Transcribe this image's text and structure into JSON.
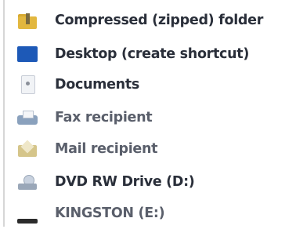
{
  "context_menu": {
    "items": [
      {
        "label": "Compressed (zipped) folder",
        "icon": "zip-folder-icon"
      },
      {
        "label": "Desktop (create shortcut)",
        "icon": "desktop-icon"
      },
      {
        "label": "Documents",
        "icon": "documents-icon"
      },
      {
        "label": "Fax recipient",
        "icon": "fax-icon"
      },
      {
        "label": "Mail recipient",
        "icon": "mail-icon"
      },
      {
        "label": "DVD RW Drive (D:)",
        "icon": "dvd-drive-icon"
      },
      {
        "label": "KINGSTON (E:)",
        "icon": "usb-drive-icon"
      }
    ]
  }
}
